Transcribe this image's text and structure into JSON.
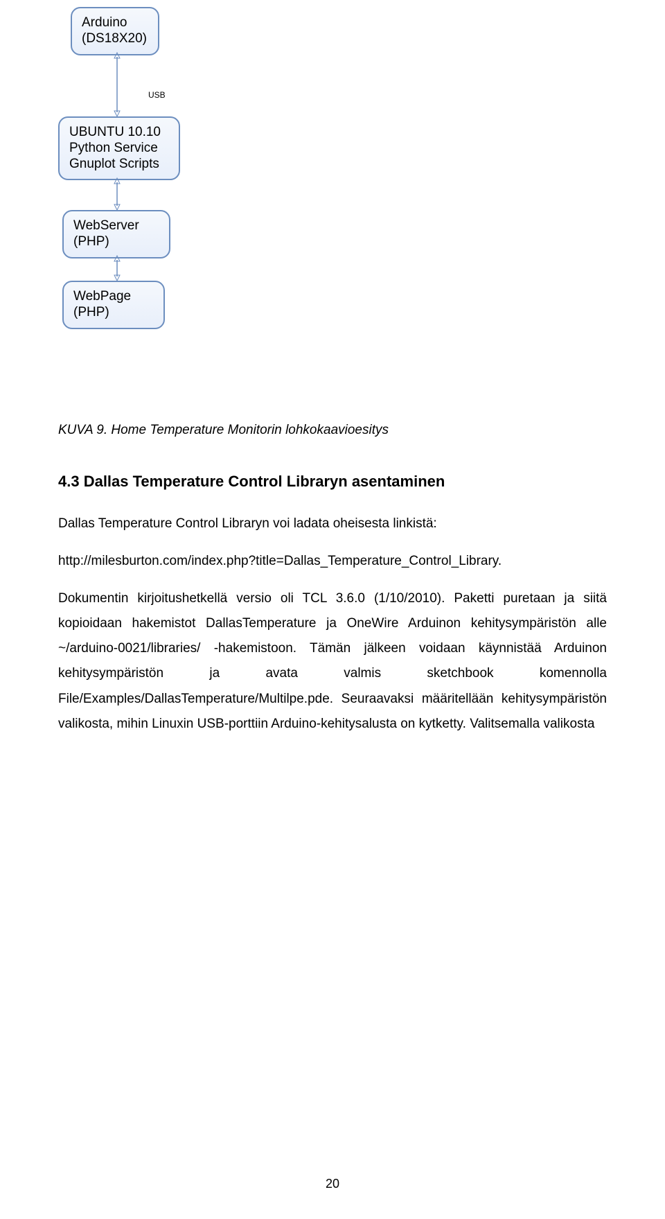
{
  "diagram": {
    "node1": {
      "line1": "Arduino",
      "line2": "(DS18X20)"
    },
    "usb_label": "USB",
    "node2": {
      "line1": "UBUNTU 10.10",
      "line2": "Python Service",
      "line3": "Gnuplot Scripts"
    },
    "node3": {
      "line1": "WebServer",
      "line2": "(PHP)"
    },
    "node4": {
      "line1": "WebPage",
      "line2": "(PHP)"
    }
  },
  "caption": "KUVA 9. Home Temperature Monitorin  lohkokaavioesitys",
  "heading": "4.3 Dallas Temperature Control Libraryn asentaminen",
  "para1": "Dallas Temperature Control Libraryn voi ladata oheisesta linkistä:",
  "link": "http://milesburton.com/index.php?title=Dallas_Temperature_Control_Library",
  "para2": "Dokumentin kirjoitushetkellä versio oli TCL 3.6.0 (1/10/2010). Paketti puretaan ja siitä kopioidaan hakemistot DallasTemperature ja OneWire Arduinon kehitysympäristön alle ~/arduino-0021/libraries/ -hakemistoon. Tämän jälkeen voidaan käynnistää Arduinon kehitysympäristön ja avata valmis sketchbook komennolla File/Examples/DallasTemperature/Multilpe.pde. Seuraavaksi määritellään kehitysympäristön valikosta, mihin Linuxin USB-porttiin Arduino-kehitysalusta on kytketty. Valitsemalla valikosta",
  "link_suffix": ".",
  "page_number": "20"
}
